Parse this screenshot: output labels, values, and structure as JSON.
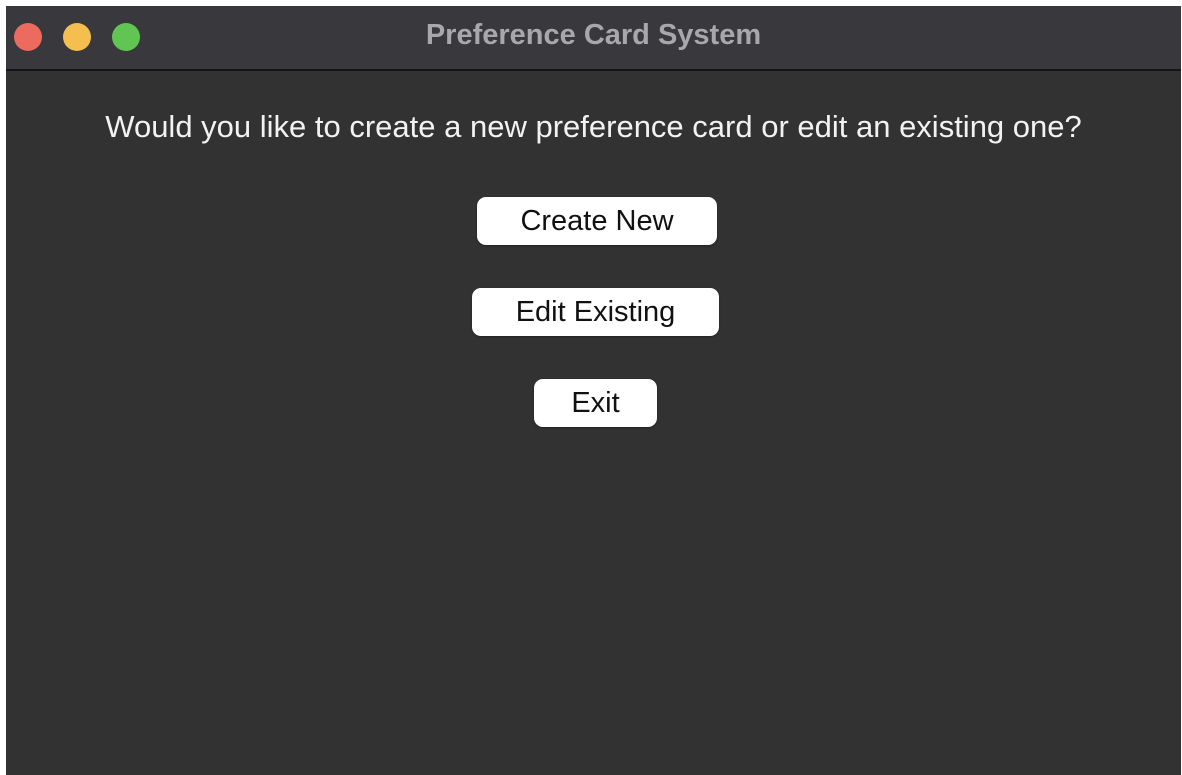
{
  "window": {
    "title": "Preference Card System",
    "controls": {
      "close_color": "#ed6a5e",
      "minimize_color": "#f4bf4f",
      "zoom_color": "#61c554"
    }
  },
  "main": {
    "question": "Would you like to create a new preference card or edit an existing one?",
    "buttons": {
      "create_label": "Create New",
      "edit_label": "Edit Existing",
      "exit_label": "Exit"
    }
  },
  "colors": {
    "background": "#323232",
    "titlebar": "#39383d",
    "button": "#ffffff",
    "text": "#f2f2f2"
  }
}
